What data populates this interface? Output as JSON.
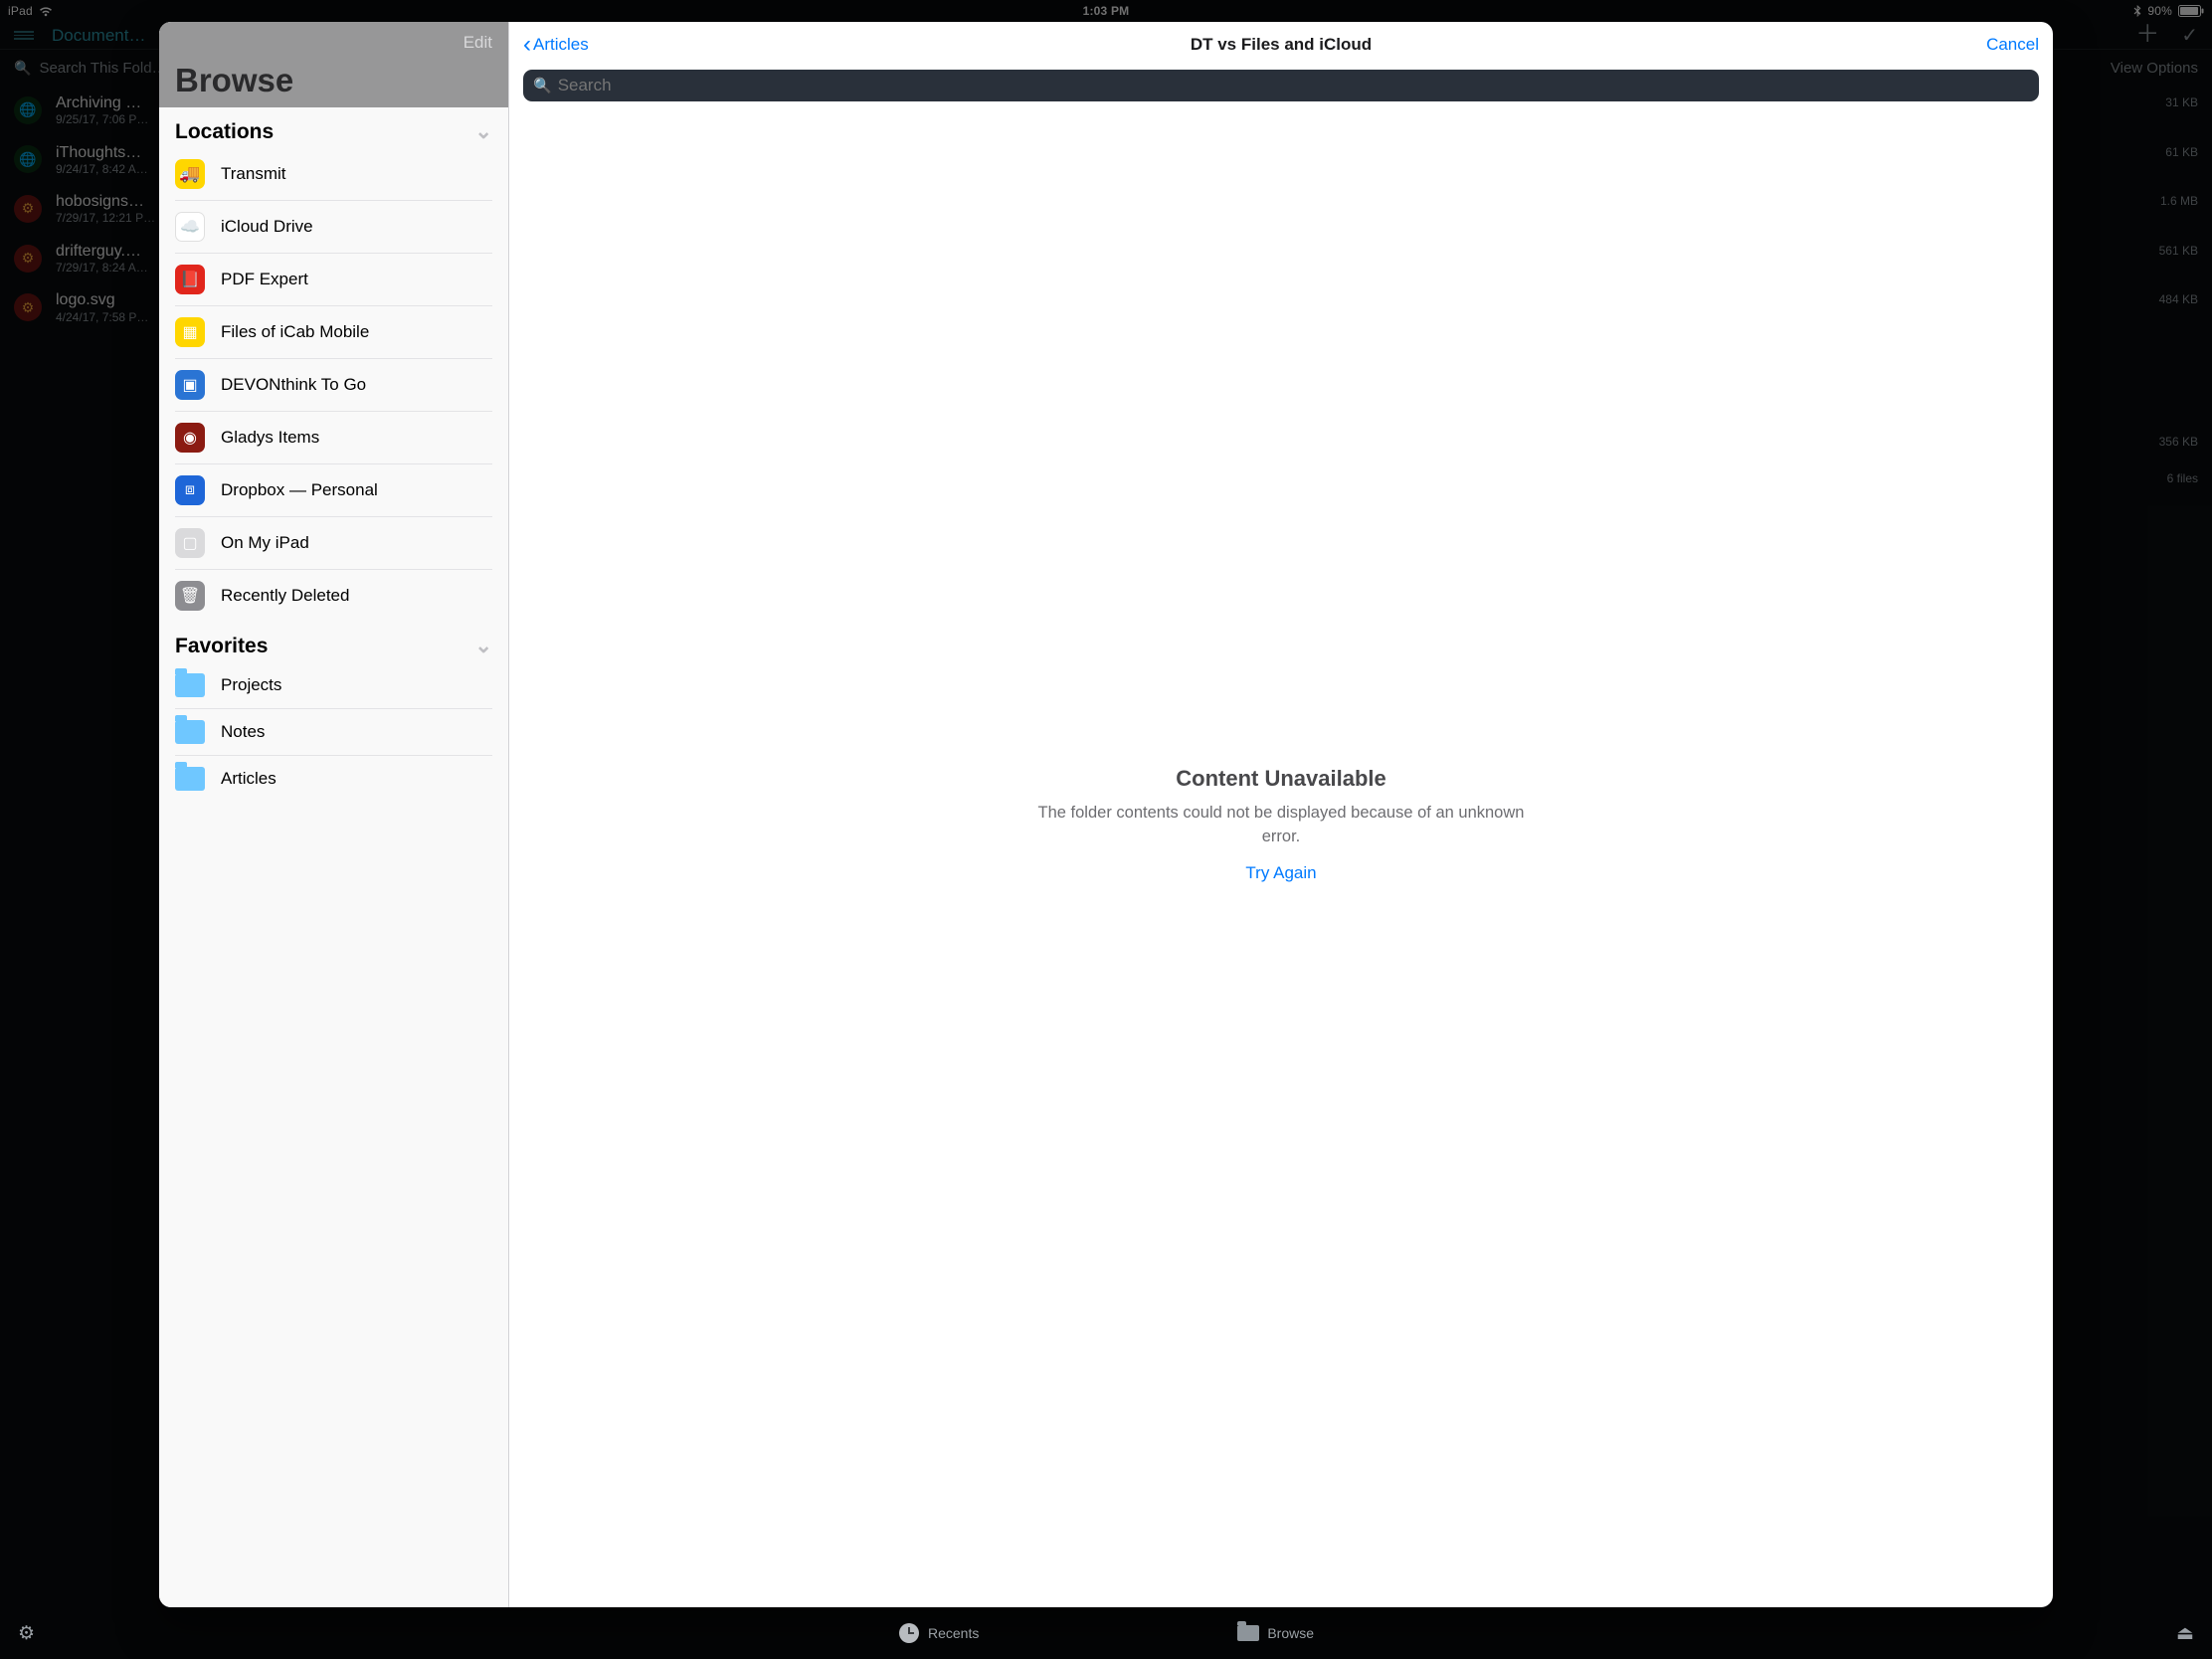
{
  "status": {
    "device": "iPad",
    "time": "1:03 PM",
    "battery": "90%"
  },
  "bgApp": {
    "title": "Document…",
    "searchPlaceholder": "Search This Fold…",
    "viewOptions": "View Options",
    "rows": [
      {
        "name": "Archiving …",
        "meta": "9/25/17, 7:06 P…",
        "size": "31 KB",
        "icon": "globe"
      },
      {
        "name": "iThoughts…",
        "meta": "9/24/17, 8:42 A…",
        "size": "61 KB",
        "icon": "globe"
      },
      {
        "name": "hobosigns…",
        "meta": "7/29/17, 12:21 P…",
        "size": "1.6 MB",
        "icon": "gear"
      },
      {
        "name": "drifterguy.…",
        "meta": "7/29/17, 8:24 A…",
        "size": "561 KB",
        "icon": "gear"
      },
      {
        "name": "logo.svg",
        "meta": "4/24/17, 7:58 P…",
        "size": "484 KB",
        "extra1": "356 KB",
        "extra2": "6 files",
        "icon": "gear"
      }
    ]
  },
  "files": {
    "editLabel": "Edit",
    "browseTitle": "Browse",
    "sections": {
      "locations": "Locations",
      "favorites": "Favorites"
    },
    "locations": [
      {
        "name": "Transmit",
        "icon": "transmit"
      },
      {
        "name": "iCloud Drive",
        "icon": "icloud"
      },
      {
        "name": "PDF Expert",
        "icon": "pdfexpert"
      },
      {
        "name": "Files of iCab Mobile",
        "icon": "icab"
      },
      {
        "name": "DEVONthink To Go",
        "icon": "devon"
      },
      {
        "name": "Gladys Items",
        "icon": "gladys"
      },
      {
        "name": "Dropbox — Personal",
        "icon": "dropbox"
      },
      {
        "name": "On My iPad",
        "icon": "ipad"
      },
      {
        "name": "Recently Deleted",
        "icon": "trash"
      }
    ],
    "favorites": [
      {
        "name": "Projects"
      },
      {
        "name": "Notes"
      },
      {
        "name": "Articles"
      }
    ]
  },
  "detail": {
    "backLabel": "Articles",
    "title": "DT vs Files and iCloud",
    "cancelLabel": "Cancel",
    "searchPlaceholder": "Search",
    "errorTitle": "Content Unavailable",
    "errorMessage": "The folder contents could not be displayed because of an unknown error.",
    "tryAgain": "Try Again"
  },
  "tabbar": {
    "recents": "Recents",
    "browse": "Browse"
  }
}
